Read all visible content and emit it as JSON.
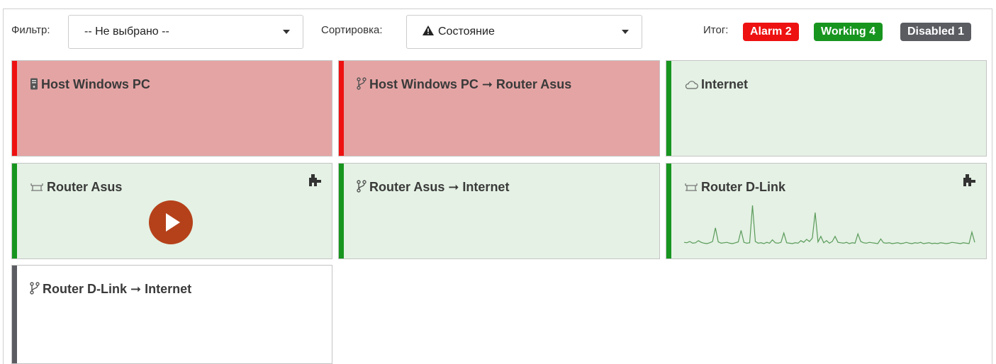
{
  "colors": {
    "alarm": "#ee1111",
    "working": "#17951f",
    "disabled": "#5a5c62",
    "alarm_bg": "#e5a4a4",
    "working_bg": "#e4f1e4",
    "disabled_bg": "#ffffff",
    "sparkline": "#5a9a5a",
    "play": "#b5411a"
  },
  "toolbar": {
    "filter_label": "Фильтр:",
    "filter_value": "-- Не выбрано --",
    "sort_label": "Сортировка:",
    "sort_icon": "warning-triangle-icon",
    "sort_value": "Состояние",
    "total_label": "Итог:",
    "badges": {
      "alarm": "Alarm 2",
      "working": "Working 4",
      "disabled": "Disabled 1"
    }
  },
  "cards": [
    {
      "title": "Host Windows PC",
      "icon": "computer-icon",
      "state": "alarm"
    },
    {
      "title": "Host Windows PC ➞ Router Asus",
      "icon": "link-icon",
      "state": "alarm"
    },
    {
      "title": "Internet",
      "icon": "cloud-icon",
      "state": "working"
    },
    {
      "title": "Router Asus",
      "icon": "router-icon",
      "state": "working",
      "plugin_icon": "plugin-icon",
      "action": "play-icon"
    },
    {
      "title": "Router Asus ➞ Internet",
      "icon": "link-icon",
      "state": "working"
    },
    {
      "title": "Router D-Link",
      "icon": "router-icon",
      "state": "working",
      "plugin_icon": "plugin-icon",
      "sparkline": [
        0.08,
        0.07,
        0.1,
        0.06,
        0.07,
        0.12,
        0.08,
        0.06,
        0.05,
        0.07,
        0.1,
        0.42,
        0.09,
        0.06,
        0.07,
        0.08,
        0.06,
        0.05,
        0.07,
        0.09,
        0.36,
        0.08,
        0.06,
        0.07,
        0.95,
        0.1,
        0.06,
        0.07,
        0.05,
        0.08,
        0.06,
        0.14,
        0.07,
        0.06,
        0.08,
        0.3,
        0.07,
        0.06,
        0.05,
        0.07,
        0.06,
        0.12,
        0.08,
        0.15,
        0.1,
        0.18,
        0.78,
        0.09,
        0.22,
        0.07,
        0.12,
        0.06,
        0.1,
        0.22,
        0.08,
        0.07,
        0.06,
        0.08,
        0.05,
        0.07,
        0.06,
        0.28,
        0.1,
        0.07,
        0.06,
        0.08,
        0.07,
        0.06,
        0.05,
        0.16,
        0.07,
        0.06,
        0.07,
        0.05,
        0.06,
        0.07,
        0.05,
        0.06,
        0.08,
        0.06,
        0.05,
        0.07,
        0.06,
        0.08,
        0.05,
        0.06,
        0.07,
        0.05,
        0.06,
        0.05,
        0.07,
        0.06,
        0.05,
        0.06,
        0.08,
        0.07,
        0.06,
        0.05,
        0.07,
        0.06,
        0.05,
        0.32,
        0.08
      ]
    },
    {
      "title": "Router D-Link ➞ Internet",
      "icon": "link-icon",
      "state": "disabled"
    }
  ]
}
